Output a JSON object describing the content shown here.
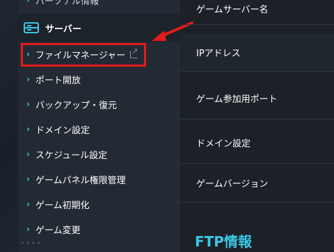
{
  "sidebar": {
    "cut_item_label": "パーソナル情報",
    "header_label": "サーバー",
    "items": [
      {
        "label": "ファイルマネージャー",
        "external": true
      },
      {
        "label": "ポート開放"
      },
      {
        "label": "バックアップ・復元"
      },
      {
        "label": "ドメイン設定"
      },
      {
        "label": "スケジュール設定"
      },
      {
        "label": "ゲームパネル権限管理"
      },
      {
        "label": "ゲーム初期化"
      },
      {
        "label": "ゲーム変更"
      }
    ],
    "chevron": "›",
    "bottom_dots": "••••"
  },
  "content": {
    "rows": [
      {
        "label": "ゲームサーバー名"
      },
      {
        "label": "IPアドレス"
      },
      {
        "label": "ゲーム参加用ポート"
      },
      {
        "label": "ドメイン設定"
      },
      {
        "label": "ゲームバージョン"
      }
    ],
    "section_title": "FTP情報"
  },
  "colors": {
    "accent": "#3cc8e6",
    "highlight": "#e31b1b",
    "background": "#1c2128",
    "sidebar": "#232a33"
  },
  "icons": {
    "header": "server-icon",
    "external": "external-link-icon",
    "chevron": "chevron-right-icon"
  }
}
